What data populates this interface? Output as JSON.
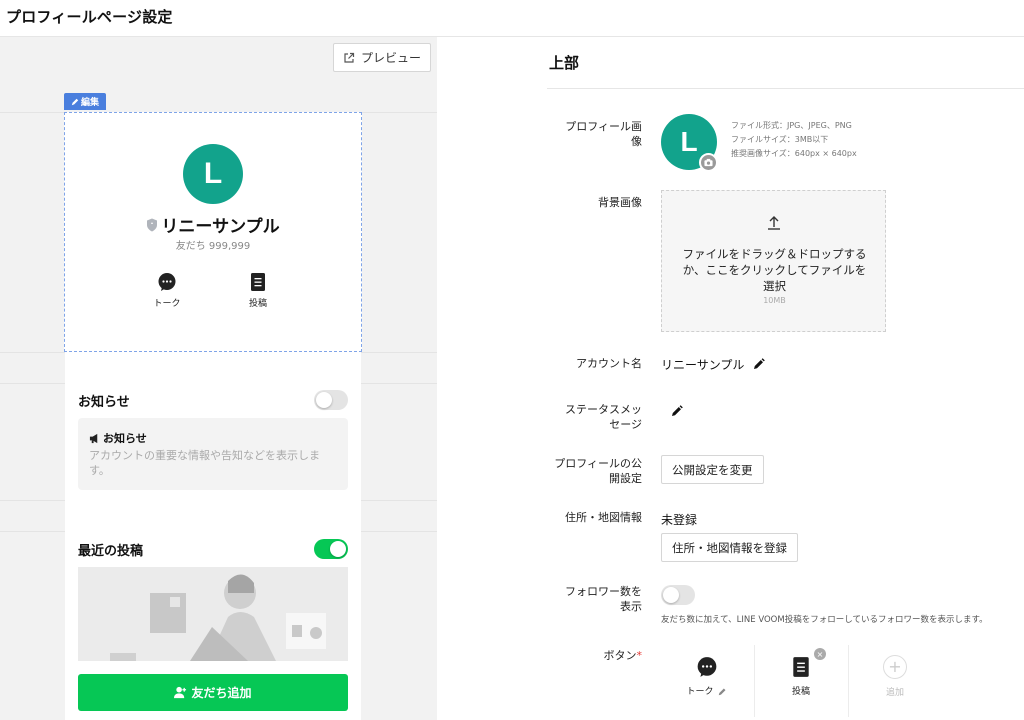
{
  "header": {
    "title": "プロフィールページ設定"
  },
  "preview": {
    "preview_button": "プレビュー",
    "edit_tag": "編集",
    "avatar_letter": "L",
    "account_name": "リニーサンプル",
    "friends_count": "友だち 999,999",
    "actions": [
      {
        "label": "トーク",
        "icon": "chat-bubble-icon"
      },
      {
        "label": "投稿",
        "icon": "post-icon"
      }
    ],
    "notice": {
      "title": "お知らせ",
      "enabled": false,
      "box_title": "お知らせ",
      "box_desc": "アカウントの重要な情報や告知などを表示します。"
    },
    "recent_posts": {
      "title": "最近の投稿",
      "enabled": true
    },
    "add_friend_button": "友だち追加"
  },
  "settings": {
    "section_title": "上部",
    "profile_image": {
      "label": "プロフィール画像",
      "avatar_letter": "L",
      "specs": [
        "ファイル形式：JPG、JPEG、PNG",
        "ファイルサイズ：3MB以下",
        "推奨画像サイズ：640px × 640px"
      ]
    },
    "background_image": {
      "label": "背景画像",
      "dropzone_text": "ファイルをドラッグ＆ドロップするか、ここをクリックしてファイルを選択",
      "size_limit": "10MB"
    },
    "account_name": {
      "label": "アカウント名",
      "value": "リニーサンプル"
    },
    "status_message": {
      "label": "ステータスメッセージ",
      "value": ""
    },
    "visibility": {
      "label": "プロフィールの公開設定",
      "button": "公開設定を変更"
    },
    "address": {
      "label": "住所・地図情報",
      "value": "未登録",
      "button": "住所・地図情報を登録"
    },
    "follower_count": {
      "label": "フォロワー数を表示",
      "enabled": false,
      "note": "友だち数に加えて、LINE VOOM投稿をフォローしているフォロワー数を表示します。"
    },
    "buttons": {
      "label": "ボタン",
      "required_mark": "*",
      "tiles": [
        {
          "label": "トーク",
          "icon": "chat-bubble-icon"
        },
        {
          "label": "投稿",
          "icon": "post-icon"
        },
        {
          "label": "追加",
          "icon": "add-icon"
        }
      ]
    }
  },
  "colors": {
    "accent_green": "#06c755",
    "avatar_teal": "#12a38c",
    "edit_blue": "#4a7fde"
  }
}
